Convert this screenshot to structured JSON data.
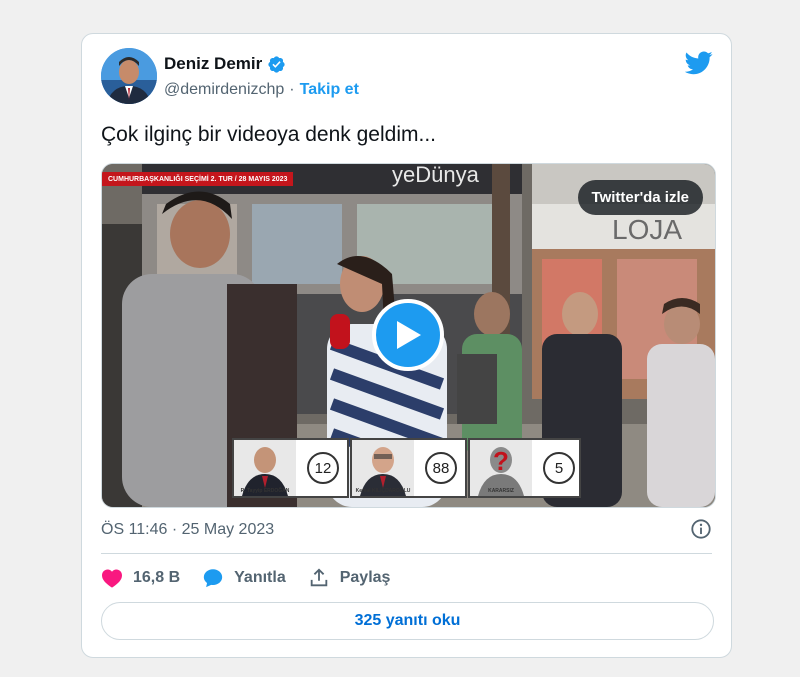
{
  "tweet": {
    "display_name": "Deniz Demir",
    "handle": "@demirdenizchp",
    "separator": "·",
    "follow_label": "Takip et",
    "text": "Çok ilginç bir videoya denk geldim...",
    "timestamp": "ÖS 11:46 · 25 May 2023"
  },
  "media": {
    "watch_label": "Twitter'da izle",
    "banner_text": "CUMHURBAŞKANLIĞI SEÇİMİ 2. TUR / 28 MAYIS 2023",
    "store_sign": "yeDünya",
    "store_sign2": "LOJA",
    "poll": [
      {
        "name": "R. Tayyip ERDOĞAN",
        "count": "12"
      },
      {
        "name": "Kemal KILIÇDAROĞLU",
        "count": "88"
      },
      {
        "name": "KARARSIZ",
        "count": "5"
      }
    ]
  },
  "actions": {
    "like_count": "16,8 B",
    "reply_label": "Yanıtla",
    "share_label": "Paylaş"
  },
  "read_replies_label": "325 yanıtı oku",
  "colors": {
    "accent": "#1d9bf0",
    "like": "#f91880",
    "text": "#0f1419",
    "muted": "#536471"
  }
}
